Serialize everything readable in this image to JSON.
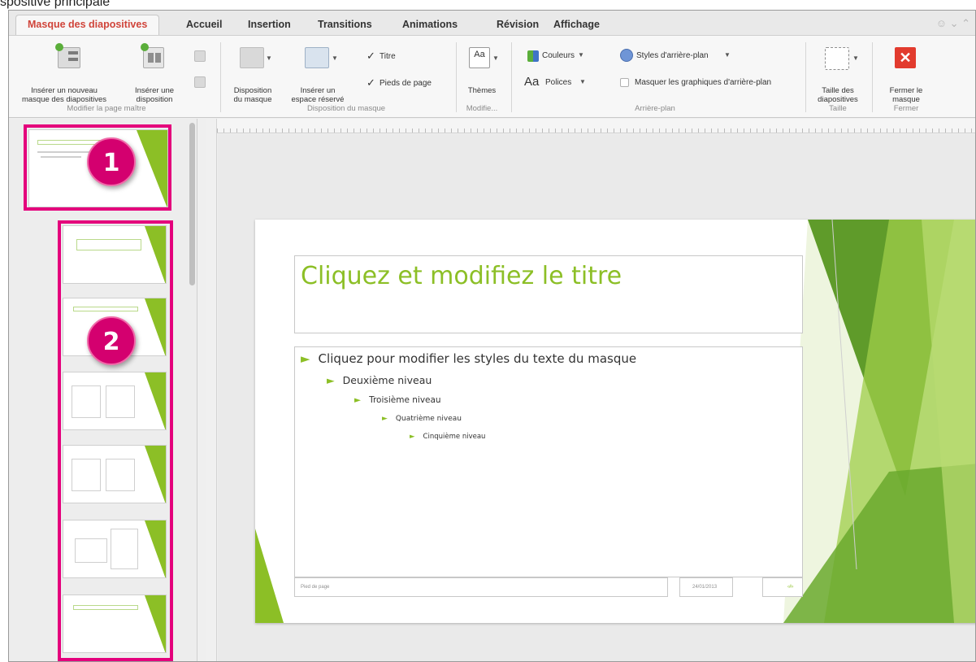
{
  "caption": "spositive principale",
  "tabs": [
    {
      "label": "Masque des diapositives",
      "active": true
    },
    {
      "label": "Accueil"
    },
    {
      "label": "Insertion"
    },
    {
      "label": "Transitions"
    },
    {
      "label": "Animations"
    },
    {
      "label": "Révision"
    },
    {
      "label": "Affichage"
    }
  ],
  "ribbon": {
    "insert_master": [
      "Insérer un nouveau",
      "masque des diapositives"
    ],
    "insert_layout": [
      "Insérer une",
      "disposition"
    ],
    "group_edit_master": "Modifier la page maître",
    "master_layout": [
      "Disposition",
      "du masque"
    ],
    "insert_placeholder": [
      "Insérer un",
      "espace réservé"
    ],
    "title_check": "Titre",
    "footers_check": "Pieds de page",
    "group_master_layout": "Disposition du masque",
    "themes": "Thèmes",
    "group_edit_theme": "Modifie...",
    "colors": "Couleurs",
    "fonts": "Polices",
    "fonts_prefix": "Aa",
    "bg_styles": "Styles d'arrière-plan",
    "hide_bg": "Masquer les graphiques d'arrière-plan",
    "group_background": "Arrière-plan",
    "slide_size": [
      "Taille des",
      "diapositives"
    ],
    "group_size": "Taille",
    "close_master": [
      "Fermer le",
      "masque"
    ],
    "group_close": "Fermer"
  },
  "badges": {
    "one": "1",
    "two": "2"
  },
  "slide": {
    "title": "Cliquez et modifiez le titre",
    "levels": [
      "Cliquez pour modifier les styles du texte du masque",
      "Deuxième niveau",
      "Troisième niveau",
      "Quatrième niveau",
      "Cinquième niveau"
    ],
    "bullet": "►",
    "footer": "Pied de page",
    "date": "24/01/2013",
    "page_num": "‹#›"
  },
  "colors": {
    "accent_green": "#8cbf26",
    "active_tab": "#d0443a",
    "highlight_pink": "#e4007c",
    "badge_fill": "#d4006f"
  }
}
